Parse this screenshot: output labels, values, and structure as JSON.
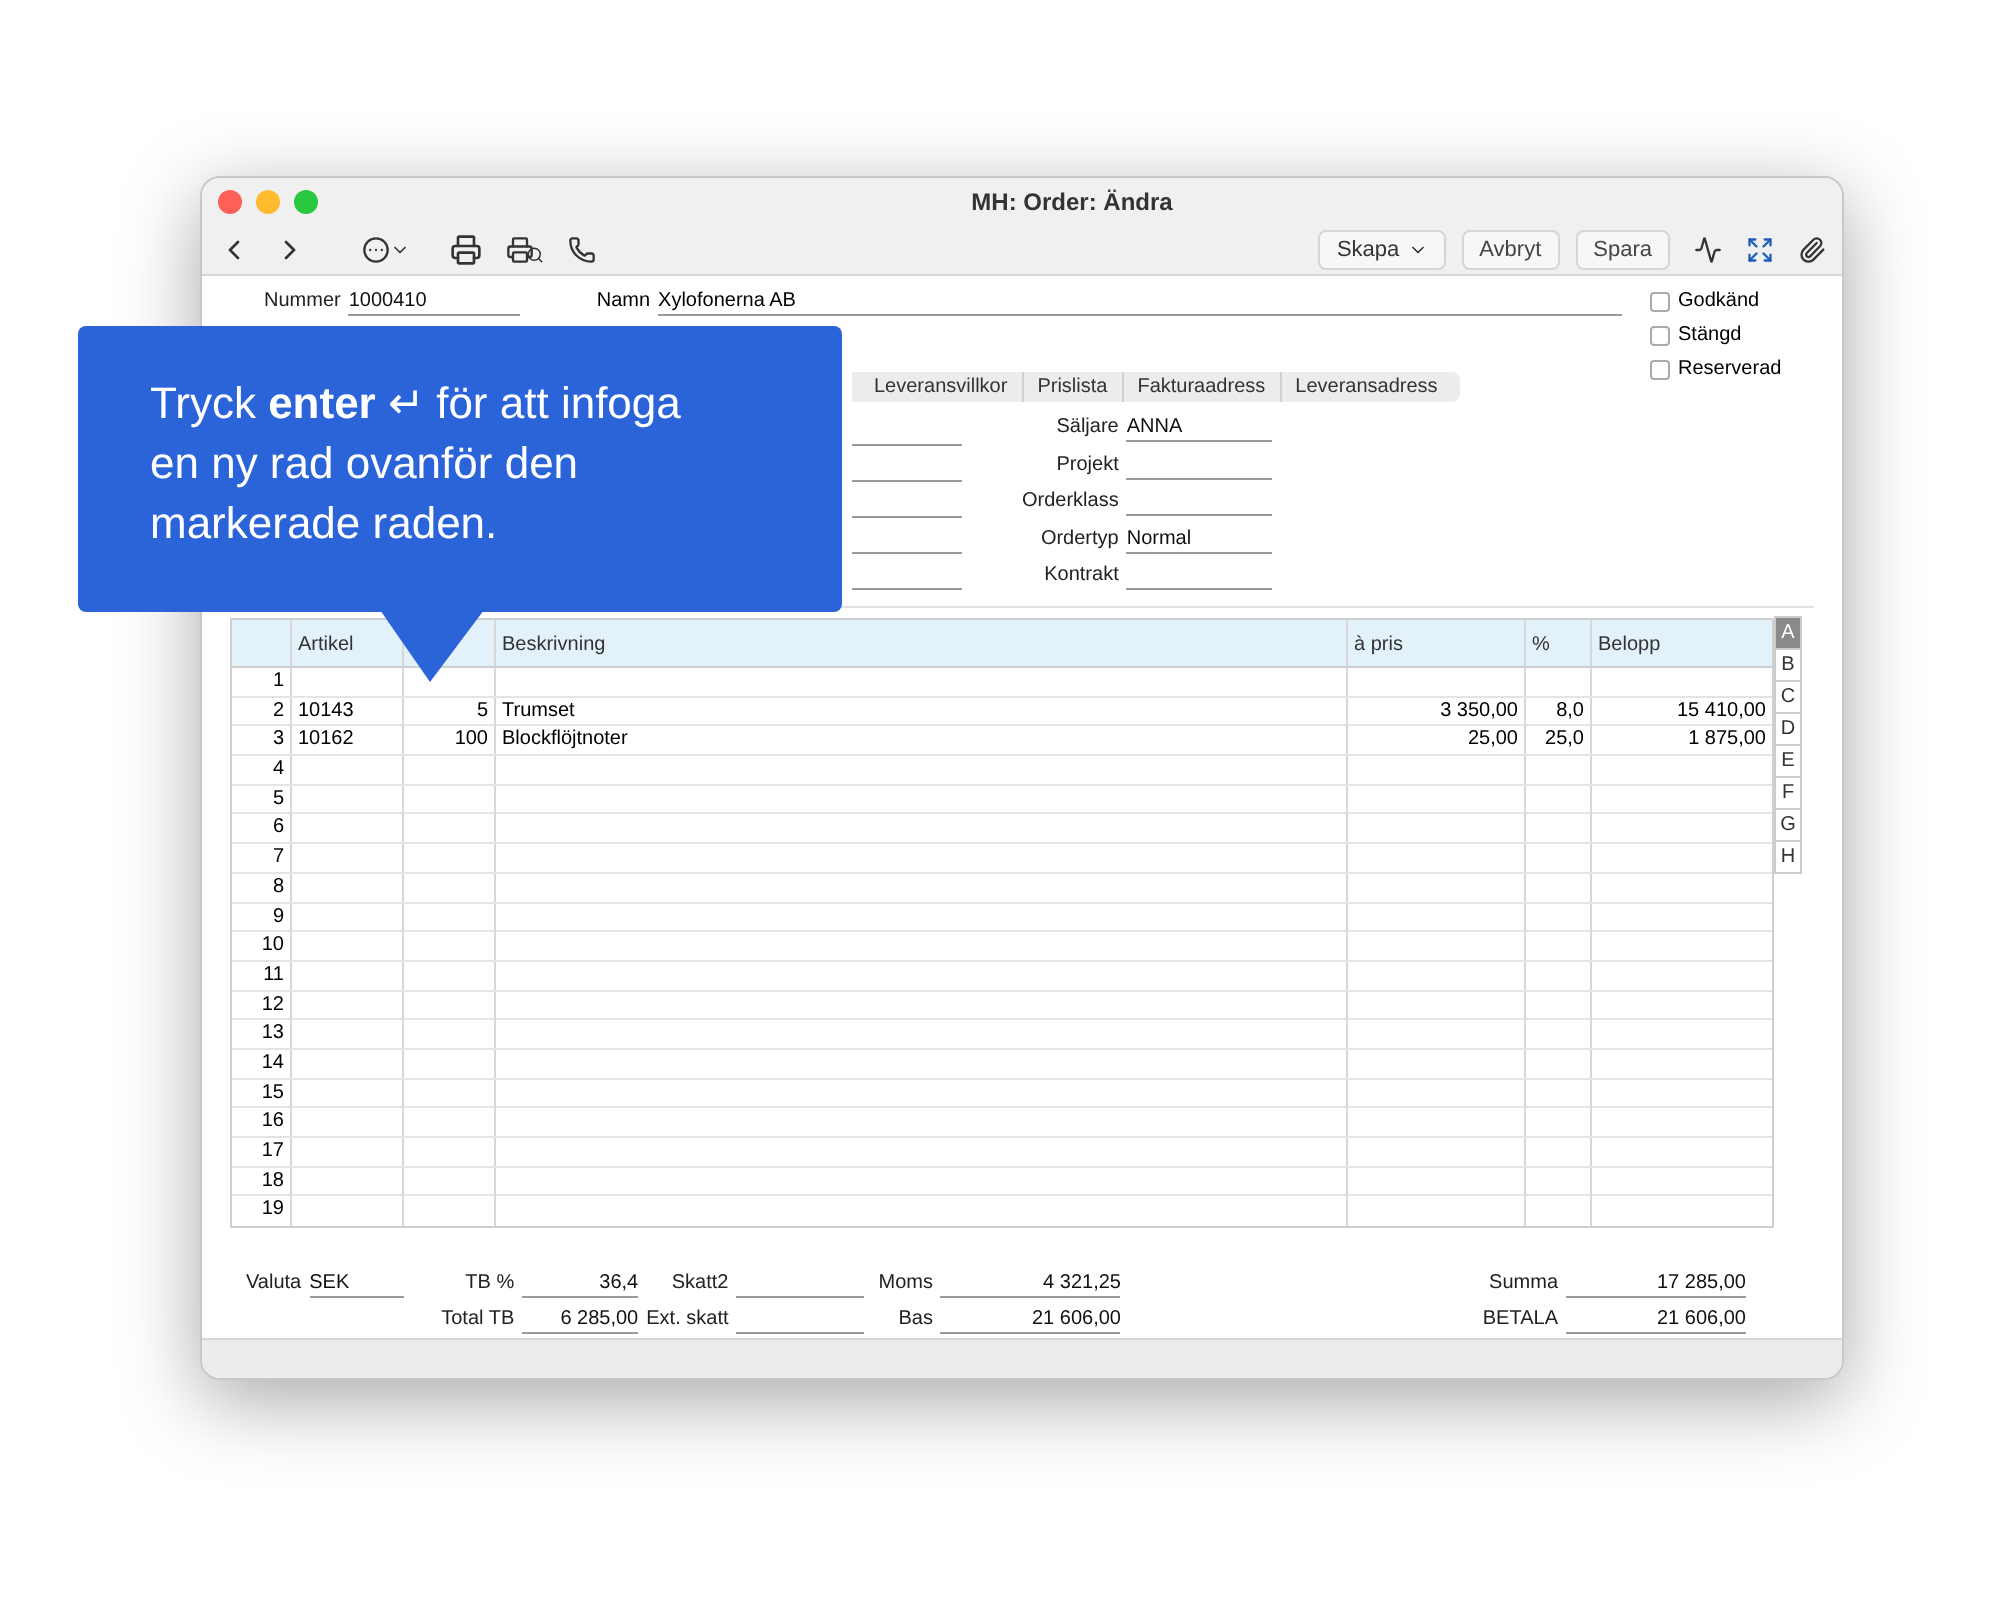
{
  "window": {
    "title": "MH: Order: Ändra"
  },
  "toolbar": {
    "create": {
      "label": "Skapa"
    },
    "buttons": [
      "Avbryt",
      "Spara"
    ]
  },
  "header": {
    "nummer": {
      "label": "Nummer",
      "value": "1000410"
    },
    "namn": {
      "label": "Namn",
      "value": "Xylofonerna AB"
    }
  },
  "checkboxes": [
    {
      "label": "Godkänd",
      "checked": false
    },
    {
      "label": "Stängd",
      "checked": false
    },
    {
      "label": "Reserverad",
      "checked": false
    }
  ],
  "tabs": [
    {
      "label": "Leveransvillkor",
      "selected": false
    },
    {
      "label": "Prislista",
      "selected": false
    },
    {
      "label": "Fakturaadress",
      "selected": false
    },
    {
      "label": "Leveransadress",
      "selected": false
    }
  ],
  "fields": [
    {
      "label": "Säljare",
      "value": "ANNA"
    },
    {
      "label": "Projekt"
    },
    {
      "label": "Orderklass"
    },
    {
      "label": "Ordertyp",
      "value": "Normal"
    },
    {
      "label": "Kontrakt"
    }
  ],
  "table": {
    "columns": [
      {
        "label": "Artikel",
        "kind": "text"
      },
      {
        "kind": "number"
      },
      {
        "label": "Beskrivning",
        "kind": "text"
      },
      {
        "label": "à pris",
        "kind": "number"
      },
      {
        "label": "%",
        "kind": "number"
      },
      {
        "label": "Belopp",
        "kind": "number"
      }
    ],
    "rows": [
      {
        "number": "1"
      },
      {
        "number": "2",
        "cells": [
          "10143",
          "5",
          "Trumset",
          "3 350,00",
          "8,0",
          "15 410,00"
        ]
      },
      {
        "number": "3",
        "cells": [
          "10162",
          "100",
          "Blockflöjtnoter",
          "25,00",
          "25,0",
          "1 875,00"
        ]
      },
      {
        "number": "4"
      },
      {
        "number": "5"
      },
      {
        "number": "6"
      },
      {
        "number": "7"
      },
      {
        "number": "8"
      },
      {
        "number": "9"
      },
      {
        "number": "10"
      },
      {
        "number": "11"
      },
      {
        "number": "12"
      },
      {
        "number": "13"
      },
      {
        "number": "14"
      },
      {
        "number": "15"
      },
      {
        "number": "16"
      },
      {
        "number": "17"
      },
      {
        "number": "18"
      },
      {
        "number": "19"
      }
    ]
  },
  "side_tabs": [
    {
      "label": "A",
      "selected": true
    },
    {
      "label": "B",
      "selected": false
    },
    {
      "label": "C",
      "selected": false
    },
    {
      "label": "D",
      "selected": false
    },
    {
      "label": "E",
      "selected": false
    },
    {
      "label": "F",
      "selected": false
    },
    {
      "label": "G",
      "selected": false
    },
    {
      "label": "H",
      "selected": false
    }
  ],
  "footer": {
    "columns": [
      [
        {
          "label": "Valuta",
          "value": "SEK"
        }
      ],
      [
        {
          "label": "TB %",
          "value": "36,4"
        },
        {
          "label": "Total TB",
          "value": "6 285,00"
        }
      ],
      [
        {
          "label": "Skatt2"
        },
        {
          "label": "Ext. skatt"
        }
      ],
      [
        {
          "label": "Moms",
          "value": "4 321,25"
        },
        {
          "label": "Bas",
          "value": "21 606,00"
        }
      ],
      [
        {
          "label": "Summa",
          "value": "17 285,00"
        },
        {
          "label": "BETALA",
          "value": "21 606,00"
        }
      ]
    ]
  },
  "callout": {
    "text": "Tryck **enter** ↵ för att infoga en ny rad ovanför den markerade raden."
  }
}
